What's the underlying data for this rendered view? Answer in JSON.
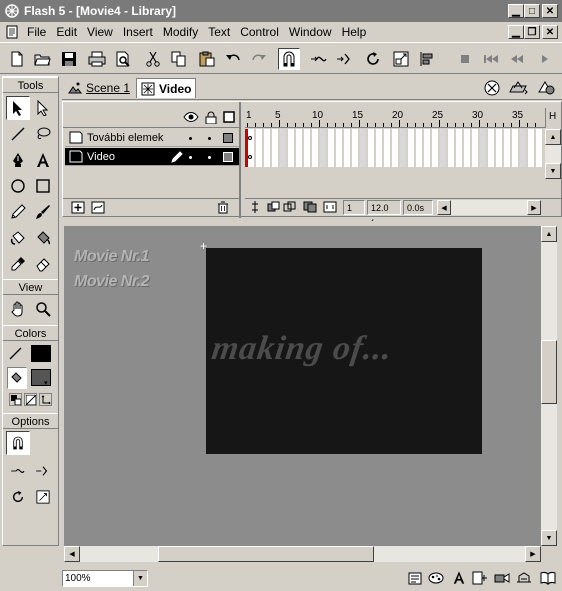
{
  "window": {
    "title": "Flash 5 - [Movie4 - Library]",
    "controls": [
      "minimize",
      "maximize",
      "close"
    ]
  },
  "menu": {
    "items": [
      "File",
      "Edit",
      "View",
      "Insert",
      "Modify",
      "Text",
      "Control",
      "Window",
      "Help"
    ]
  },
  "toolbar": {
    "buttons": [
      "new-file-icon",
      "open-icon",
      "save-icon",
      "print-icon",
      "print-preview-icon",
      "cut-icon",
      "copy-icon",
      "paste-icon",
      "undo-icon",
      "redo-icon",
      "snap-magnet-icon",
      "smooth-icon",
      "straighten-icon",
      "rotate-icon",
      "scale-icon",
      "align-icon",
      "stop-icon",
      "rewind-icon",
      "step-back-icon",
      "play-icon"
    ]
  },
  "tools_panel": {
    "tools_header": "Tools",
    "view_header": "View",
    "colors_header": "Colors",
    "options_header": "Options",
    "stroke_color": "#000000",
    "fill_color": "#555555"
  },
  "scene_bar": {
    "scene_tab": "Scene 1",
    "symbol_tab": "Video"
  },
  "timeline": {
    "layers": [
      {
        "name": "További elemek",
        "selected": false
      },
      {
        "name": "Video",
        "selected": true
      }
    ],
    "ruler_numbers": [
      "1",
      "5",
      "10",
      "15",
      "20",
      "25",
      "30",
      "35"
    ],
    "current_frame": "1",
    "frame_rate": "12.0 fps",
    "elapsed_time": "0.0s",
    "ruler_end_label": "H"
  },
  "stage": {
    "movie_labels": [
      "Movie Nr.1",
      "Movie Nr.2"
    ],
    "movie_text": "making of...",
    "background_color": "#8c8c8c",
    "movie_color": "#161616"
  },
  "status_bar": {
    "zoom": "100%"
  }
}
